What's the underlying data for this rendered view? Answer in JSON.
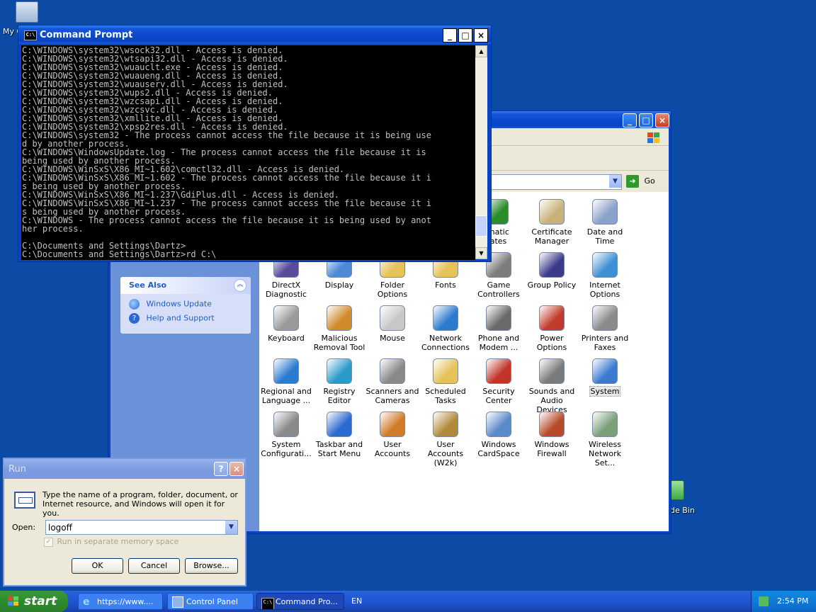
{
  "desktop": {
    "my_computer_label": "My C",
    "recycle_bin_label": "de Bin"
  },
  "control_panel": {
    "go_label": "Go",
    "see_also": {
      "title": "See Also",
      "links": [
        "Windows Update",
        "Help and Support"
      ]
    },
    "items": [
      {
        "label": "omatic\ndates",
        "color": "#2c8c2c"
      },
      {
        "label": "Certificate\nManager",
        "color": "#c9b27a"
      },
      {
        "label": "Date and Time",
        "color": "#8aa1c9"
      },
      {
        "label": "DirectX\nDiagnostic",
        "color": "#5a4a9a"
      },
      {
        "label": "Display",
        "color": "#4d8ad6"
      },
      {
        "label": "Folder Options",
        "color": "#e6c25a"
      },
      {
        "label": "Fonts",
        "color": "#e6c25a"
      },
      {
        "label": "Game\nControllers",
        "color": "#7d7d7d"
      },
      {
        "label": "Group Policy",
        "color": "#3a3a8a"
      },
      {
        "label": "Internet\nOptions",
        "color": "#3b8fd4"
      },
      {
        "label": "Keyboard",
        "color": "#9a9a9a"
      },
      {
        "label": "Malicious\nRemoval Tool",
        "color": "#d08a2a"
      },
      {
        "label": "Mouse",
        "color": "#c8c8c8"
      },
      {
        "label": "Network\nConnections",
        "color": "#2a7ad0"
      },
      {
        "label": "Phone and\nModem ...",
        "color": "#6a6a6a"
      },
      {
        "label": "Power Options",
        "color": "#c23a2a"
      },
      {
        "label": "Printers and\nFaxes",
        "color": "#8a8a8a"
      },
      {
        "label": "Regional and\nLanguage ...",
        "color": "#2a7ad0"
      },
      {
        "label": "Registry Editor",
        "color": "#2a9acb"
      },
      {
        "label": "Scanners and\nCameras",
        "color": "#8a8a8a"
      },
      {
        "label": "Scheduled\nTasks",
        "color": "#e6c25a"
      },
      {
        "label": "Security\nCenter",
        "color": "#c2342a"
      },
      {
        "label": "Sounds and\nAudio Devices",
        "color": "#7a7a7a"
      },
      {
        "label": "System",
        "color": "#3a7ad0"
      },
      {
        "label": "System\nConfigurati...",
        "color": "#8a8a8a"
      },
      {
        "label": "Taskbar and\nStart Menu",
        "color": "#2a6ad0"
      },
      {
        "label": "User Accounts",
        "color": "#d07a2a"
      },
      {
        "label": "User Accounts\n(W2k)",
        "color": "#b08a3a"
      },
      {
        "label": "Windows\nCardSpace",
        "color": "#5a8ac8"
      },
      {
        "label": "Windows\nFirewall",
        "color": "#b84a2a"
      },
      {
        "label": "Wireless\nNetwork Set...",
        "color": "#7aa07a"
      }
    ]
  },
  "cmd": {
    "title": "Command Prompt",
    "lines": [
      "C:\\WINDOWS\\system32\\wsock32.dll - Access is denied.",
      "C:\\WINDOWS\\system32\\wtsapi32.dll - Access is denied.",
      "C:\\WINDOWS\\system32\\wuauclt.exe - Access is denied.",
      "C:\\WINDOWS\\system32\\wuaueng.dll - Access is denied.",
      "C:\\WINDOWS\\system32\\wuauserv.dll - Access is denied.",
      "C:\\WINDOWS\\system32\\wups2.dll - Access is denied.",
      "C:\\WINDOWS\\system32\\wzcsapi.dll - Access is denied.",
      "C:\\WINDOWS\\system32\\wzcsvc.dll - Access is denied.",
      "C:\\WINDOWS\\system32\\xmllite.dll - Access is denied.",
      "C:\\WINDOWS\\system32\\xpsp2res.dll - Access is denied.",
      "C:\\WINDOWS\\system32 - The process cannot access the file because it is being use",
      "d by another process.",
      "C:\\WINDOWS\\WindowsUpdate.log - The process cannot access the file because it is",
      "being used by another process.",
      "C:\\WINDOWS\\WinSxS\\X86_MI~1.602\\comctl32.dll - Access is denied.",
      "C:\\WINDOWS\\WinSxS\\X86_MI~1.602 - The process cannot access the file because it i",
      "s being used by another process.",
      "C:\\WINDOWS\\WinSxS\\X86_MI~1.237\\GdiPlus.dll - Access is denied.",
      "C:\\WINDOWS\\WinSxS\\X86_MI~1.237 - The process cannot access the file because it i",
      "s being used by another process.",
      "C:\\WINDOWS - The process cannot access the file because it is being used by anot",
      "her process.",
      "",
      "C:\\Documents and Settings\\Dartz>",
      "C:\\Documents and Settings\\Dartz>rd C:\\"
    ]
  },
  "run": {
    "title": "Run",
    "description": "Type the name of a program, folder, document, or\nInternet resource, and Windows will open it for you.",
    "open_label": "Open:",
    "open_value": "logoff",
    "checkbox_label": "Run in separate memory space",
    "ok": "OK",
    "cancel": "Cancel",
    "browse": "Browse..."
  },
  "taskbar": {
    "start": "start",
    "tasks": [
      "https://www....",
      "Control Panel",
      "Command Pro..."
    ],
    "language": "EN",
    "clock": "2:54 PM"
  }
}
